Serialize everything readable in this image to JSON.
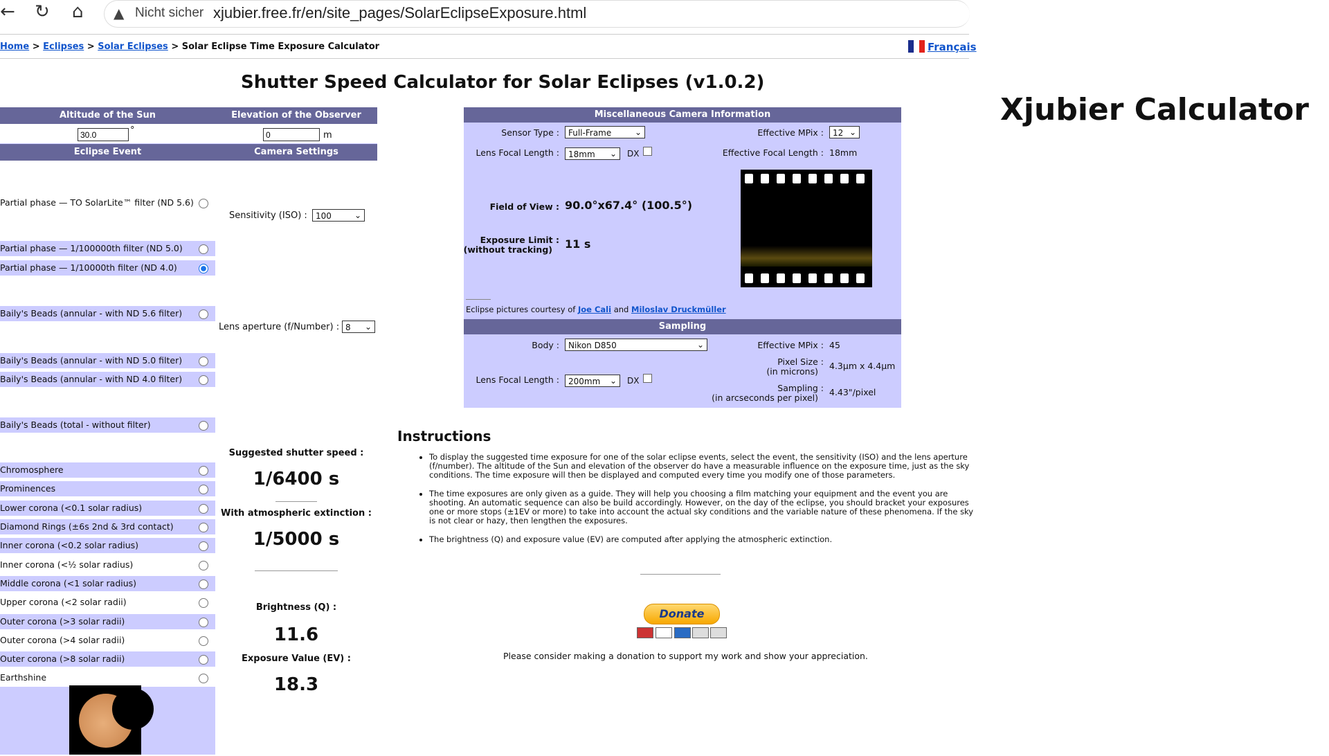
{
  "browser": {
    "not_secure": "Nicht sicher",
    "url": "xjubier.free.fr/en/site_pages/SolarEclipseExposure.html"
  },
  "breadcrumb": {
    "home": "Home",
    "eclipses": "Eclipses",
    "solar_eclipses": "Solar Eclipses",
    "current": "Solar Eclipse Time Exposure Calculator",
    "sep": ">"
  },
  "lang_link": "Français",
  "page_title": "Shutter Speed Calculator for Solar Eclipses (v1.0.2)",
  "side_title": "Xjubier Calculator",
  "form": {
    "altitude_header": "Altitude of the Sun",
    "elevation_header": "Elevation of the Observer",
    "altitude_value": "30.0",
    "altitude_unit": "°",
    "elevation_value": "0",
    "elevation_unit": "m",
    "event_header": "Eclipse Event",
    "camera_header": "Camera Settings",
    "iso_label": "Sensitivity (ISO) :",
    "iso_value": "100",
    "aperture_label": "Lens aperture (f/Number) :",
    "aperture_value": "8",
    "events": [
      {
        "label": "Partial phase — TO SolarLite™ filter (ND 5.6)",
        "checked": false
      },
      {
        "label": "Partial phase — 1/100000th filter (ND 5.0)",
        "checked": false
      },
      {
        "label": "Partial phase — 1/10000th filter (ND 4.0)",
        "checked": true
      },
      {
        "label": "Baily's Beads (annular - with ND 5.6 filter)",
        "checked": false
      },
      {
        "label": "Baily's Beads (annular - with ND 5.0 filter)",
        "checked": false
      },
      {
        "label": "Baily's Beads (annular - with ND 4.0 filter)",
        "checked": false
      },
      {
        "label": "Baily's Beads (total - without filter)",
        "checked": false
      },
      {
        "label": "Chromosphere",
        "checked": false
      },
      {
        "label": "Prominences",
        "checked": false
      },
      {
        "label": "Lower corona (<0.1 solar radius)",
        "checked": false
      },
      {
        "label": "Diamond Rings (±6s 2nd & 3rd contact)",
        "checked": false
      },
      {
        "label": "Inner corona (<0.2 solar radius)",
        "checked": false
      },
      {
        "label": "Inner corona (<½ solar radius)",
        "checked": false
      },
      {
        "label": "Middle corona (<1 solar radius)",
        "checked": false
      },
      {
        "label": "Upper corona (<2 solar radii)",
        "checked": false
      },
      {
        "label": "Outer corona (>3 solar radii)",
        "checked": false
      },
      {
        "label": "Outer corona (>4 solar radii)",
        "checked": false
      },
      {
        "label": "Outer corona (>8 solar radii)",
        "checked": false
      },
      {
        "label": "Earthshine",
        "checked": false
      }
    ]
  },
  "results": {
    "suggested_label": "Suggested shutter speed :",
    "suggested_value": "1/6400 s",
    "atmo_label": "With atmospheric extinction :",
    "atmo_value": "1/5000 s",
    "brightness_label": "Brightness (Q) :",
    "brightness_value": "11.6",
    "ev_label": "Exposure Value (EV) :",
    "ev_value": "18.3"
  },
  "misc": {
    "header": "Miscellaneous Camera Information",
    "sensor_label": "Sensor Type :",
    "sensor_value": "Full-Frame",
    "mpix_label": "Effective MPix :",
    "mpix_value": "12",
    "focal_label": "Lens Focal Length :",
    "focal_value": "18mm",
    "dx_label": "DX",
    "eff_focal_label": "Effective Focal Length :",
    "eff_focal_value": "18mm",
    "fov_label": "Field of View :",
    "fov_value": "90.0°x67.4° (100.5°)",
    "exp_limit_label": "Exposure Limit :",
    "exp_limit_sub": "(without tracking)",
    "exp_limit_value": "11 s",
    "courtesy_prefix": "Eclipse pictures courtesy of",
    "courtesy_name1": "Joe Cali",
    "courtesy_and": "and",
    "courtesy_name2": "Miloslav Druckmüller"
  },
  "sampling": {
    "header": "Sampling",
    "body_label": "Body :",
    "body_value": "Nikon D850",
    "mpix_label": "Effective MPix :",
    "mpix_value": "45",
    "pixel_label": "Pixel Size :",
    "pixel_sub": "(in microns)",
    "pixel_value": "4.3µm x 4.4µm",
    "focal_label": "Lens Focal Length :",
    "focal_value": "200mm",
    "dx_label": "DX",
    "sampling_label": "Sampling :",
    "sampling_sub": "(in arcseconds per pixel)",
    "sampling_value": "4.43\"/pixel"
  },
  "instructions": {
    "title": "Instructions",
    "items": [
      "To display the suggested time exposure for one of the solar eclipse events, select the event, the sensitivity (ISO) and the lens aperture (f/number). The altitude of the Sun and elevation of the observer do have a measurable influence on the exposure time, just as the sky conditions. The time exposure will then be displayed and computed every time you modify one of those parameters.",
      "The time exposures are only given as a guide. They will help you choosing a film matching your equipment and the event you are shooting. An automatic sequence can also be build accordingly. However, on the day of the eclipse, you should bracket your exposures one or more stops (±1EV or more) to take into account the actual sky conditions and the variable nature of these phenomena. If the sky is not clear or hazy, then lengthen the exposures.",
      "The brightness (Q) and exposure value (EV) are computed after applying the atmospheric extinction."
    ]
  },
  "donate": {
    "button": "Donate",
    "text": "Please consider making a donation to support my work and show your appreciation."
  },
  "colors": {
    "header_bg": "#666699",
    "panel_bg": "#ccccff",
    "link": "#1155cc"
  }
}
